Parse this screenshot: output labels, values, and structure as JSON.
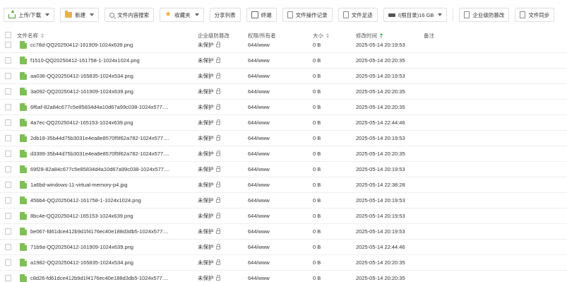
{
  "toolbar": {
    "upload_download": "上传/下载",
    "new": "新建",
    "content_search": "文件内容搜索",
    "favorites": "收藏夹",
    "share_list": "分享列表",
    "terminal": "终端",
    "file_op_log": "文件操作记录",
    "file_traces": "文件足迹",
    "disk_path": "/(根目录)16 GB",
    "enterprise_tamper": "企业级防篡改",
    "file_sync": "文件同步"
  },
  "table": {
    "headers": {
      "name": "文件名称",
      "protection": "企业级防篡改",
      "permission": "权限/所有者",
      "size": "大小",
      "modified": "修改时间",
      "note": "备注"
    },
    "rows": [
      {
        "name": "cc78d-QQ20250412-161909-1024x639.png",
        "protection": "未保护",
        "permission": "644/www",
        "size": "0 B",
        "modified": "2025-05-14 20:19:53"
      },
      {
        "name": "f1510-QQ20250412-161758-1-1024x1024.png",
        "protection": "未保护",
        "permission": "644/www",
        "size": "0 B",
        "modified": "2025-05-14 20:20:35"
      },
      {
        "name": "aa036-QQ20250412-165835-1024x534.png",
        "protection": "未保护",
        "permission": "644/www",
        "size": "0 B",
        "modified": "2025-05-14 20:19:53"
      },
      {
        "name": "3a092-QQ20250412-161909-1024x639.png",
        "protection": "未保护",
        "permission": "644/www",
        "size": "0 B",
        "modified": "2025-05-14 20:20:35"
      },
      {
        "name": "6f6af-82a84c677c5e85834d4a10d67a99c038-1024x577....",
        "protection": "未保护",
        "permission": "644/www",
        "size": "0 B",
        "modified": "2025-05-14 20:20:35"
      },
      {
        "name": "4a7ec-QQ20250412-165153-1024x639.png",
        "protection": "未保护",
        "permission": "644/www",
        "size": "0 B",
        "modified": "2025-05-14 22:44:46"
      },
      {
        "name": "2db18-35b44d75b3031e4ea8e8570f5f62a782-1024x577....",
        "protection": "未保护",
        "permission": "644/www",
        "size": "0 B",
        "modified": "2025-05-14 20:19:53"
      },
      {
        "name": "d3399-35b44d75b3031e4ea8e8570f5f62a782-1024x577....",
        "protection": "未保护",
        "permission": "644/www",
        "size": "0 B",
        "modified": "2025-05-14 20:20:35"
      },
      {
        "name": "69f28-82a84c677c5e85834d4a10d67a99c038-1024x577....",
        "protection": "未保护",
        "permission": "644/www",
        "size": "0 B",
        "modified": "2025-05-14 20:19:53"
      },
      {
        "name": "1a6bd-windows-11-virtual-memory-p4.jpg",
        "protection": "未保护",
        "permission": "644/www",
        "size": "0 B",
        "modified": "2025-05-14 22:38:28"
      },
      {
        "name": "45bb4-QQ20250412-161758-1-1024x1024.png",
        "protection": "未保护",
        "permission": "644/www",
        "size": "0 B",
        "modified": "2025-05-14 20:19:53"
      },
      {
        "name": "8bc4e-QQ20250412-165153-1024x639.png",
        "protection": "未保护",
        "permission": "644/www",
        "size": "0 B",
        "modified": "2025-05-14 20:19:53"
      },
      {
        "name": "be067-fd61dce412b9d1f4176ec40e188d3db5-1024x577....",
        "protection": "未保护",
        "permission": "644/www",
        "size": "0 B",
        "modified": "2025-05-14 20:19:53"
      },
      {
        "name": "71b9a-QQ20250412-161909-1024x639.png",
        "protection": "未保护",
        "permission": "644/www",
        "size": "0 B",
        "modified": "2025-05-14 22:44:46"
      },
      {
        "name": "a1982-QQ20250412-165835-1024x534.png",
        "protection": "未保护",
        "permission": "644/www",
        "size": "0 B",
        "modified": "2025-05-14 20:20:35"
      },
      {
        "name": "c8d26-fd61dce412b9d1f4176ec40e188d3db5-1024x577....",
        "protection": "未保护",
        "permission": "644/www",
        "size": "0 B",
        "modified": "2025-05-14 20:20:35"
      }
    ]
  },
  "colors": {
    "accent": "#20a53a",
    "file_icon": "#7fbf55",
    "folder_icon": "#e8b24a",
    "star": "#f5a623"
  }
}
